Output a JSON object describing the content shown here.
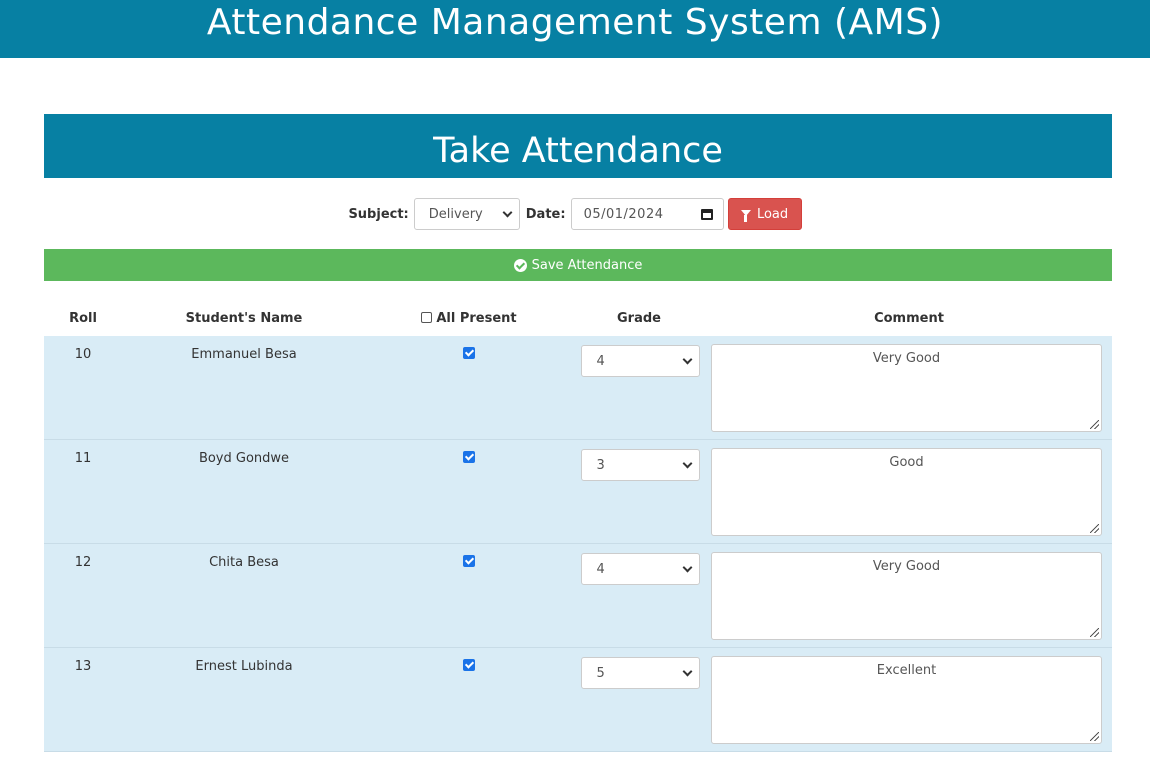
{
  "app": {
    "title": "Attendance Management System (AMS)"
  },
  "panel": {
    "title": "Take Attendance"
  },
  "filters": {
    "subject_label": "Subject:",
    "subject_value": "Delivery",
    "date_label": "Date:",
    "date_value": "05/01/2024",
    "load_label": "Load"
  },
  "save_label": "Save Attendance",
  "table": {
    "headers": {
      "roll": "Roll",
      "name": "Student's Name",
      "present": "All Present",
      "grade": "Grade",
      "comment": "Comment"
    },
    "rows": [
      {
        "roll": "10",
        "name": "Emmanuel Besa",
        "present": true,
        "grade": "4",
        "comment": "Very Good"
      },
      {
        "roll": "11",
        "name": "Boyd Gondwe",
        "present": true,
        "grade": "3",
        "comment": "Good"
      },
      {
        "roll": "12",
        "name": "Chita Besa",
        "present": true,
        "grade": "4",
        "comment": "Very Good"
      },
      {
        "roll": "13",
        "name": "Ernest Lubinda",
        "present": true,
        "grade": "5",
        "comment": "Excellent"
      }
    ]
  },
  "colors": {
    "header_bg": "#0780a3",
    "save_bg": "#5cb85c",
    "load_bg": "#d9534f",
    "row_bg": "#d9ecf6"
  },
  "icons": {
    "load": "filter-icon",
    "save": "check-circle-icon",
    "date": "calendar-icon"
  }
}
